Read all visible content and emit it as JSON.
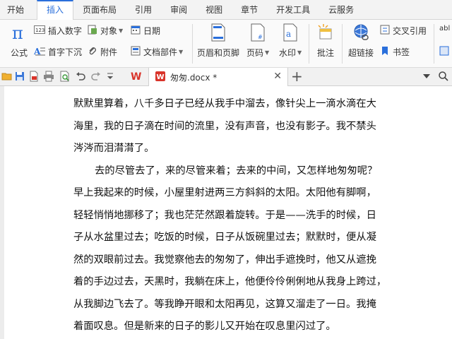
{
  "tabs": [
    {
      "label": "开始",
      "active": false
    },
    {
      "label": "插入",
      "active": true
    },
    {
      "label": "页面布局",
      "active": false
    },
    {
      "label": "引用",
      "active": false
    },
    {
      "label": "审阅",
      "active": false
    },
    {
      "label": "视图",
      "active": false
    },
    {
      "label": "章节",
      "active": false
    },
    {
      "label": "开发工具",
      "active": false
    },
    {
      "label": "云服务",
      "active": false
    }
  ],
  "ribbon": {
    "formula": "公式",
    "insert_number": "插入数字",
    "object": "对象",
    "date": "日期",
    "drop_cap": "首字下沉",
    "attachment": "附件",
    "doc_parts": "文档部件",
    "header_footer": "页眉和页脚",
    "page_number": "页码",
    "watermark": "水印",
    "comment": "批注",
    "hyperlink": "超链接",
    "cross_reference": "交叉引用",
    "bookmark": "书签",
    "partial_right": "abl"
  },
  "document": {
    "filename": "匆匆.docx *",
    "lines": [
      {
        "text": "默默里算着，八千多日子已经从我手中溜去，像针尖上一滴水滴在大",
        "indent": false
      },
      {
        "text": "海里，我的日子滴在时间的流里，没有声音，也没有影子。我不禁头",
        "indent": false
      },
      {
        "text": "涔涔而泪潸潸了。",
        "indent": false
      },
      {
        "text": "去的尽管去了，来的尽管来着；去来的中间，又怎样地匆匆呢？",
        "indent": true
      },
      {
        "text": "早上我起来的时候，小屋里射进两三方斜斜的太阳。太阳他有脚啊，",
        "indent": false
      },
      {
        "text": "轻轻悄悄地挪移了；我也茫茫然跟着旋转。于是——洗手的时候，日",
        "indent": false
      },
      {
        "text": "子从水盆里过去；吃饭的时候，日子从饭碗里过去；默默时，便从凝",
        "indent": false
      },
      {
        "text": "然的双眼前过去。我觉察他去的匆匆了，伸出手遮挽时，他又从遮挽",
        "indent": false
      },
      {
        "text": "着的手边过去，天黑时，我躺在床上，他便伶伶俐俐地从我身上跨过，",
        "indent": false
      },
      {
        "text": "从我脚边飞去了。等我睁开眼和太阳再见，这算又溜走了一日。我掩",
        "indent": false
      },
      {
        "text": "着面叹息。但是新来的日子的影儿又开始在叹息里闪过了。",
        "indent": false
      }
    ]
  },
  "colors": {
    "accent": "#2a6fdb",
    "wps_red": "#d9342b"
  }
}
